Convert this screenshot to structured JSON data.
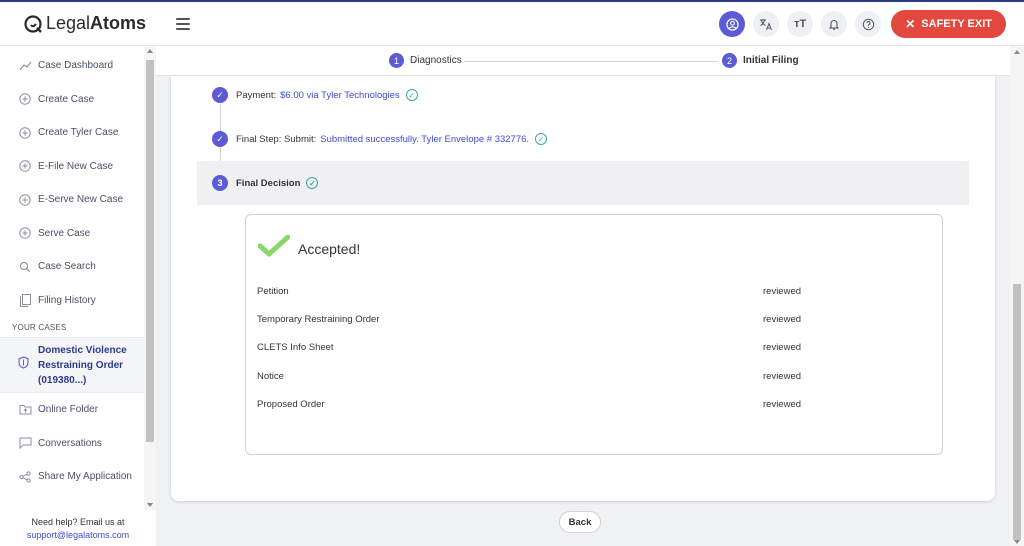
{
  "app": {
    "brand_light": "Legal",
    "brand_bold": "Atoms"
  },
  "topbar": {
    "icons": [
      "user-icon",
      "translate-icon",
      "text-size-icon",
      "bell-icon",
      "help-icon"
    ],
    "text_size_glyph": "тT",
    "safety_exit": "SAFETY EXIT",
    "accent_color": "#5b5bd6",
    "danger_color": "#e2483d"
  },
  "sidebar": {
    "items": [
      {
        "label": "Case Dashboard",
        "icon": "trend-icon"
      },
      {
        "label": "Create Case",
        "icon": "plus-circle-icon"
      },
      {
        "label": "Create Tyler Case",
        "icon": "plus-circle-icon"
      },
      {
        "label": "E-File New Case",
        "icon": "plus-circle-icon"
      },
      {
        "label": "E-Serve New Case",
        "icon": "plus-circle-icon"
      },
      {
        "label": "Serve Case",
        "icon": "plus-circle-icon"
      },
      {
        "label": "Case Search",
        "icon": "search-icon"
      },
      {
        "label": "Filing History",
        "icon": "document-icon"
      }
    ],
    "section_title": "YOUR CASES",
    "case": {
      "label": "Domestic Violence Restraining Order (019380...)",
      "icon": "shield-icon"
    },
    "bottom_items": [
      {
        "label": "Online Folder",
        "icon": "folder-upload-icon"
      },
      {
        "label": "Conversations",
        "icon": "chat-icon"
      },
      {
        "label": "Share My Application",
        "icon": "share-icon"
      }
    ],
    "help_text": "Need help? Email us at",
    "help_email": "support@legalatoms.com"
  },
  "stepper": {
    "steps": [
      {
        "num": "1",
        "label": "Diagnostics"
      },
      {
        "num": "2",
        "label": "Initial Filing"
      }
    ]
  },
  "progress": {
    "payment_label": "Payment:",
    "payment_value": "$6.00 via Tyler Technologies",
    "submit_label": "Final Step: Submit:",
    "submit_value": "Submitted successfully. Tyler Envelope # 332776.",
    "decision_num": "3",
    "decision_label": "Final Decision"
  },
  "result": {
    "title": "Accepted!",
    "documents": [
      {
        "name": "Petition",
        "status": "reviewed"
      },
      {
        "name": "Temporary Restraining Order",
        "status": "reviewed"
      },
      {
        "name": "CLETS Info Sheet",
        "status": "reviewed"
      },
      {
        "name": "Notice",
        "status": "reviewed"
      },
      {
        "name": "Proposed Order",
        "status": "reviewed"
      }
    ]
  },
  "footer": {
    "back_label": "Back"
  }
}
